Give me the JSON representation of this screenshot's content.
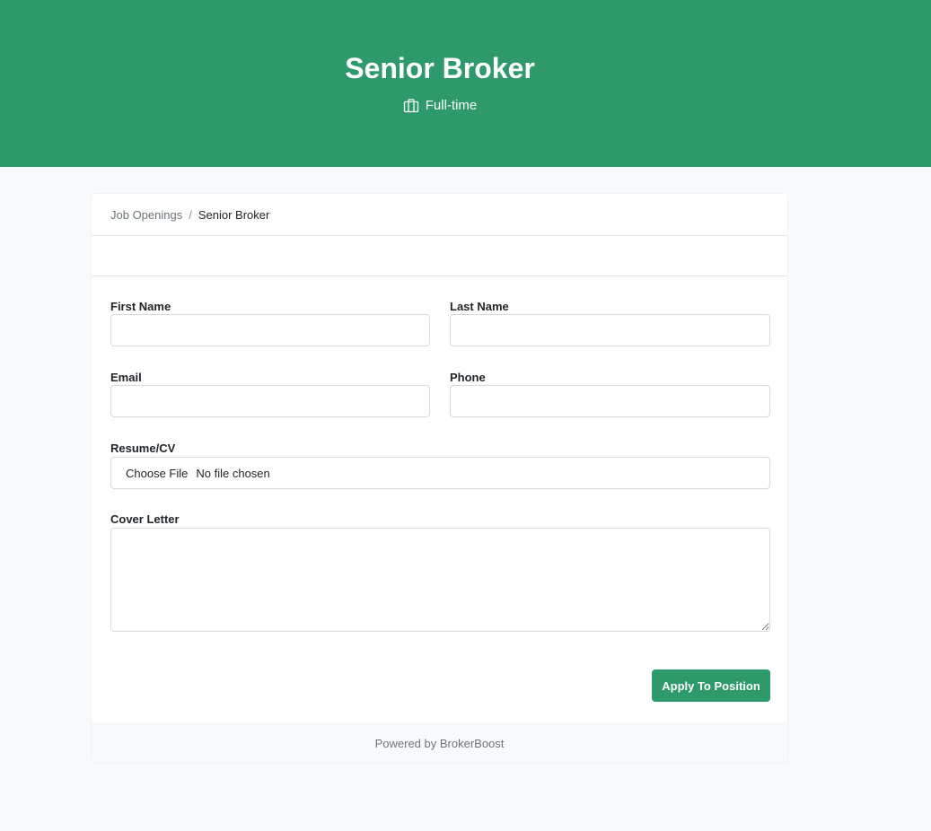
{
  "header": {
    "title": "Senior Broker",
    "employment_type": "Full-time",
    "employment_icon": "briefcase-icon",
    "background_color": "#2e996b"
  },
  "breadcrumb": {
    "parent": "Job Openings",
    "separator": "/",
    "current": "Senior Broker"
  },
  "form": {
    "first_name": {
      "label": "First Name",
      "value": "",
      "placeholder": ""
    },
    "last_name": {
      "label": "Last Name",
      "value": "",
      "placeholder": ""
    },
    "email": {
      "label": "Email",
      "value": "",
      "placeholder": ""
    },
    "phone": {
      "label": "Phone",
      "value": "",
      "placeholder": ""
    },
    "resume": {
      "label": "Resume/CV",
      "button_label": "Choose File",
      "status": "No file chosen"
    },
    "cover_letter": {
      "label": "Cover Letter",
      "value": "",
      "placeholder": ""
    },
    "submit_label": "Apply To Position",
    "submit_color": "#2e996b"
  },
  "footer": {
    "text": "Powered by BrokerBoost"
  }
}
